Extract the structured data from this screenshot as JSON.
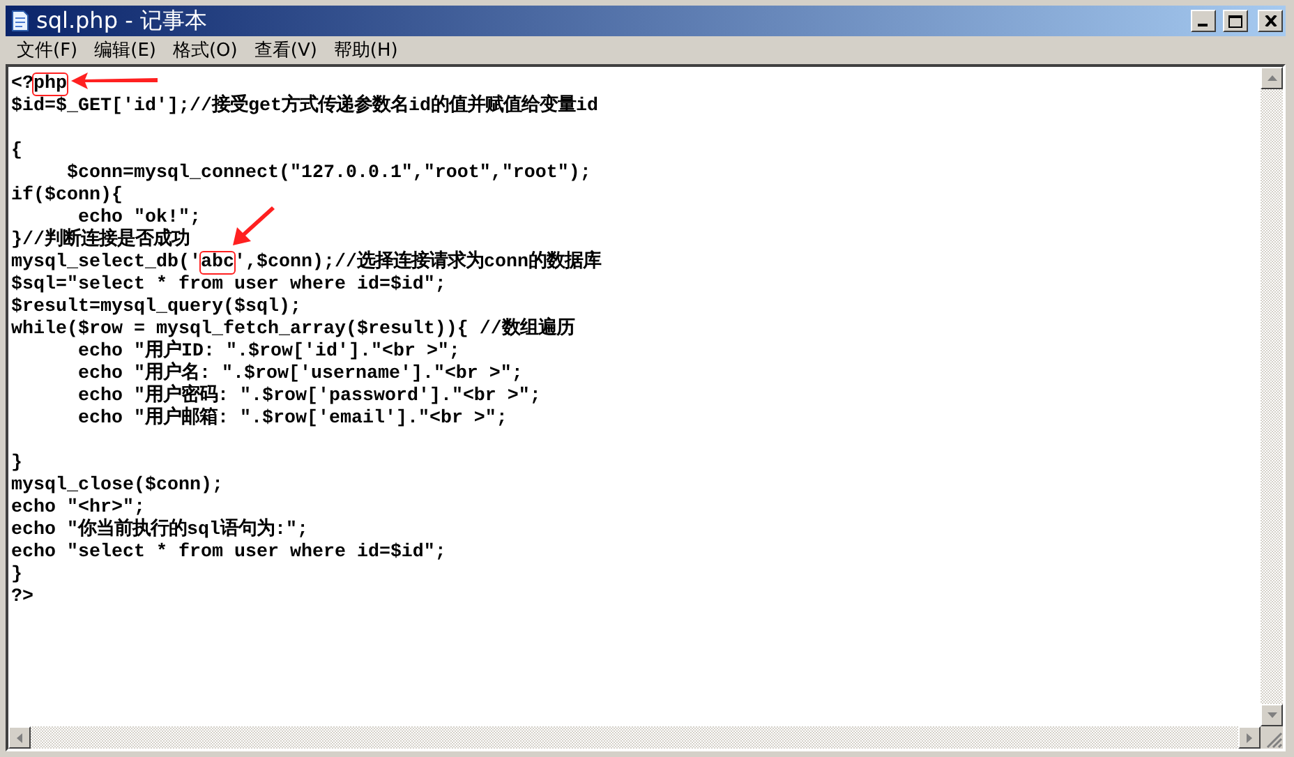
{
  "window": {
    "title": "sql.php - 记事本"
  },
  "menu": [
    "文件(F)",
    "编辑(E)",
    "格式(O)",
    "查看(V)",
    "帮助(H)"
  ],
  "lines": [
    {
      "kind": "arrow-left",
      "before": "<?",
      "boxed": "php"
    },
    {
      "kind": "plain",
      "before": "$id=$_GET['id'];//接受get方式传递参数名id的值并赋值给变量id"
    },
    {
      "kind": "plain"
    },
    {
      "kind": "plain",
      "before": "{"
    },
    {
      "kind": "plain",
      "before": "     $conn=mysql_connect(\"127.0.0.1\",\"root\",\"root\");"
    },
    {
      "kind": "plain",
      "before": "if($conn){"
    },
    {
      "kind": "plain",
      "before": "      echo \"ok!\";"
    },
    {
      "kind": "plain",
      "before": "}//判断连接是否成功"
    },
    {
      "kind": "arrow-down-left",
      "before": "mysql_select_db('",
      "boxed": "abc",
      "after": "',$conn);//选择连接请求为conn的数据库"
    },
    {
      "kind": "plain",
      "before": "$sql=\"select * from user where id=$id\";"
    },
    {
      "kind": "plain",
      "before": "$result=mysql_query($sql);"
    },
    {
      "kind": "plain",
      "before": "while($row = mysql_fetch_array($result)){ //数组遍历"
    },
    {
      "kind": "plain",
      "before": "      echo \"用户ID: \".$row['id'].\"<br >\";"
    },
    {
      "kind": "plain",
      "before": "      echo \"用户名: \".$row['username'].\"<br >\";"
    },
    {
      "kind": "plain",
      "before": "      echo \"用户密码: \".$row['password'].\"<br >\";"
    },
    {
      "kind": "plain",
      "before": "      echo \"用户邮箱: \".$row['email'].\"<br >\";"
    },
    {
      "kind": "plain"
    },
    {
      "kind": "plain",
      "before": "}"
    },
    {
      "kind": "plain",
      "before": "mysql_close($conn);"
    },
    {
      "kind": "plain",
      "before": "echo \"<hr>\";"
    },
    {
      "kind": "plain",
      "before": "echo \"你当前执行的sql语句为:\";"
    },
    {
      "kind": "plain",
      "before": "echo \"select * from user where id=$id\";"
    },
    {
      "kind": "plain",
      "before": "}"
    },
    {
      "kind": "plain",
      "before": "?>"
    }
  ]
}
